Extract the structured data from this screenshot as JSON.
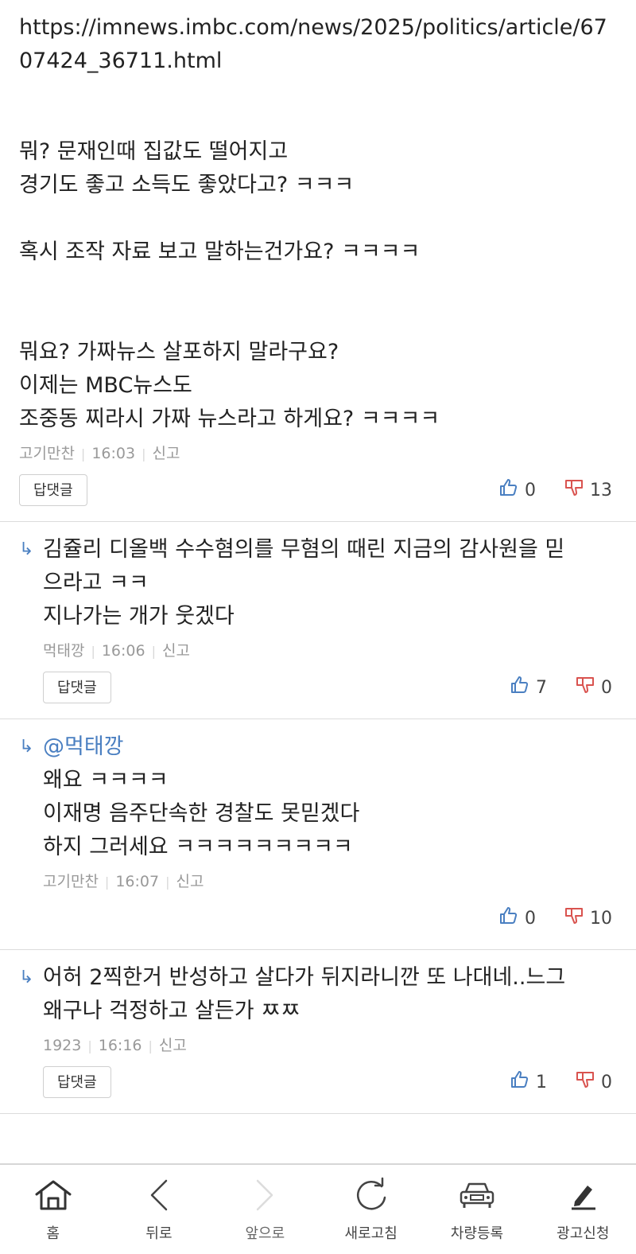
{
  "top_comment": {
    "url": "https://imnews.imbc.com/news/2025/politics/article/6707424_36711.html",
    "lines": [
      "뭐? 문재인때 집값도 떨어지고",
      "경기도 좋고 소득도 좋았다고? ㅋㅋㅋ",
      "",
      "혹시 조작 자료 보고 말하는건가요? ㅋㅋㅋㅋ",
      "",
      "",
      "뭐요? 가짜뉴스 살포하지 말라구요?",
      "이제는 MBC뉴스도",
      "조중동 찌라시 가짜 뉴스라고 하게요? ㅋㅋㅋㅋ"
    ],
    "author": "고기만찬",
    "time": "16:03",
    "report": "신고",
    "reply_button": "답댓글",
    "likes": "0",
    "dislikes": "13"
  },
  "replies": [
    {
      "lines": [
        "김쥴리 디올백 수수혐의를 무혐의 때린 지금의 감사원을 믿",
        "으라고 ㅋㅋ",
        "지나가는 개가 웃겠다"
      ],
      "author": "먹태깡",
      "time": "16:06",
      "report": "신고",
      "reply_button": "답댓글",
      "likes": "7",
      "dislikes": "0"
    },
    {
      "mention": "@먹태깡",
      "lines": [
        "왜요 ㅋㅋㅋㅋ",
        "이재명 음주단속한 경찰도 못믿겠다",
        "하지 그러세요 ㅋㅋㅋㅋㅋㅋㅋㅋㅋ"
      ],
      "author": "고기만찬",
      "time": "16:07",
      "report": "신고",
      "likes": "0",
      "dislikes": "10"
    },
    {
      "lines": [
        "어허 2찍한거 반성하고 살다가 뒤지라니깐 또 나대네..느그",
        "왜구나 걱정하고 살든가 ㅉㅉ"
      ],
      "author": "1923",
      "time": "16:16",
      "report": "신고",
      "reply_button": "답댓글",
      "likes": "1",
      "dislikes": "0"
    }
  ],
  "bottom_nav": {
    "home": "홈",
    "back": "뒤로",
    "forward": "앞으로",
    "refresh": "새로고침",
    "car_register": "차량등록",
    "ad_apply": "광고신청"
  },
  "colors": {
    "like": "#4a7fc1",
    "dislike": "#d9534f",
    "mention": "#4a7fc1"
  }
}
